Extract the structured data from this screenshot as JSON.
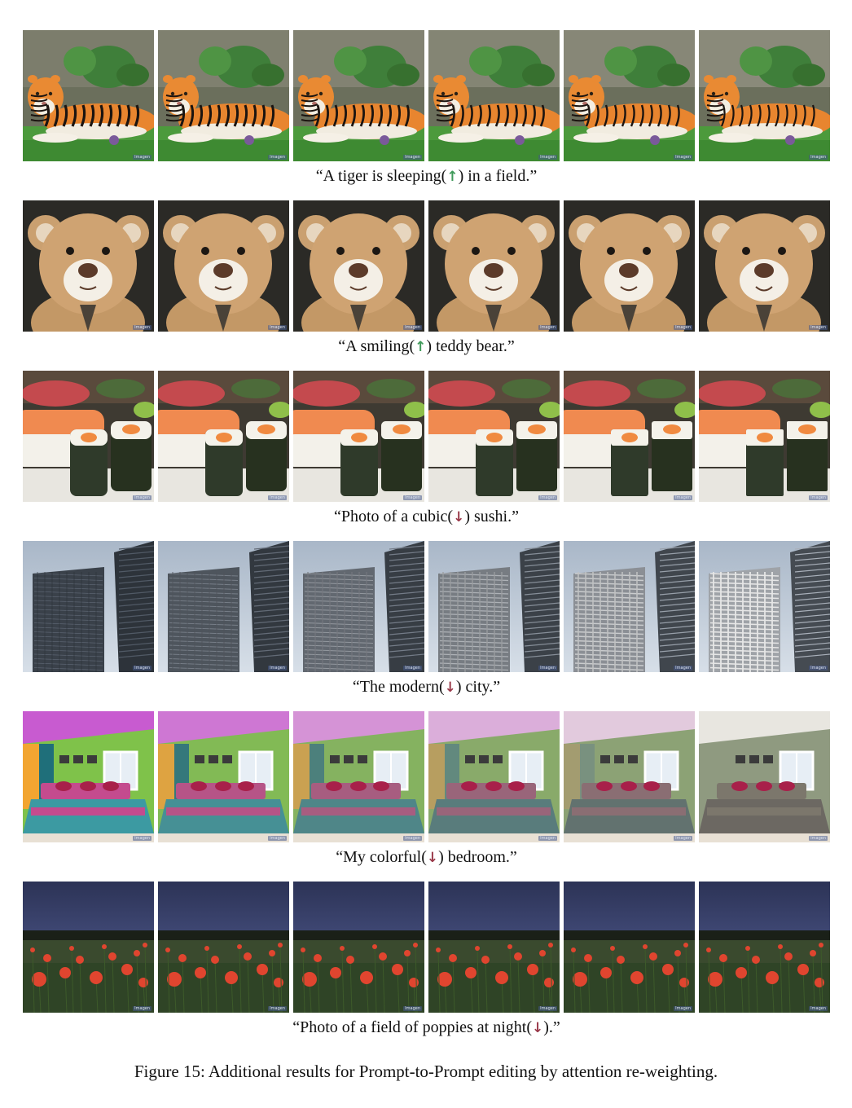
{
  "figure": {
    "caption": "Figure 15: Additional results for Prompt-to-Prompt editing by attention re-weighting.",
    "watermark": "Imagen",
    "rows": [
      {
        "id": "tiger",
        "subject": "tiger",
        "prompt_before": "“A tiger is sleeping(",
        "arrow": "↑",
        "arrow_direction": "up",
        "arrow_color": "#3f9a5a",
        "prompt_after": ") in a field.”"
      },
      {
        "id": "teddy",
        "subject": "teddy",
        "prompt_before": "“A smiling(",
        "arrow": "↑",
        "arrow_direction": "up",
        "arrow_color": "#3f9a5a",
        "prompt_after": ") teddy bear.”"
      },
      {
        "id": "sushi",
        "subject": "sushi",
        "prompt_before": "“Photo of a cubic(",
        "arrow": "↓",
        "arrow_direction": "down",
        "arrow_color": "#9a3a4a",
        "prompt_after": ") sushi.”"
      },
      {
        "id": "city",
        "subject": "city",
        "prompt_before": "“The modern(",
        "arrow": "↓",
        "arrow_direction": "down",
        "arrow_color": "#9a3a4a",
        "prompt_after": ") city.”"
      },
      {
        "id": "bedroom",
        "subject": "bedroom",
        "prompt_before": "“My colorful(",
        "arrow": "↓",
        "arrow_direction": "down",
        "arrow_color": "#9a3a4a",
        "prompt_after": ") bedroom.”"
      },
      {
        "id": "poppies",
        "subject": "poppies",
        "prompt_before": "“Photo of a field of poppies at night(",
        "arrow": "↓",
        "arrow_direction": "down",
        "arrow_color": "#9a3a4a",
        "prompt_after": ").”"
      }
    ]
  }
}
